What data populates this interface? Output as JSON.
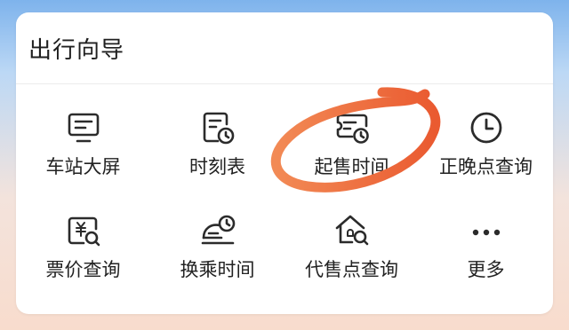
{
  "card": {
    "title": "出行向导"
  },
  "items": [
    {
      "label": "车站大屏",
      "icon": "monitor-icon"
    },
    {
      "label": "时刻表",
      "icon": "timetable-icon"
    },
    {
      "label": "起售时间",
      "icon": "ticket-clock-icon"
    },
    {
      "label": "正晚点查询",
      "icon": "clock-icon"
    },
    {
      "label": "票价查询",
      "icon": "price-search-icon"
    },
    {
      "label": "换乘时间",
      "icon": "train-clock-icon"
    },
    {
      "label": "代售点查询",
      "icon": "agency-search-icon"
    },
    {
      "label": "更多",
      "icon": "more-icon"
    }
  ],
  "colors": {
    "highlight_circle": "#ef6a3f",
    "icon_stroke": "#2b2b2b"
  }
}
